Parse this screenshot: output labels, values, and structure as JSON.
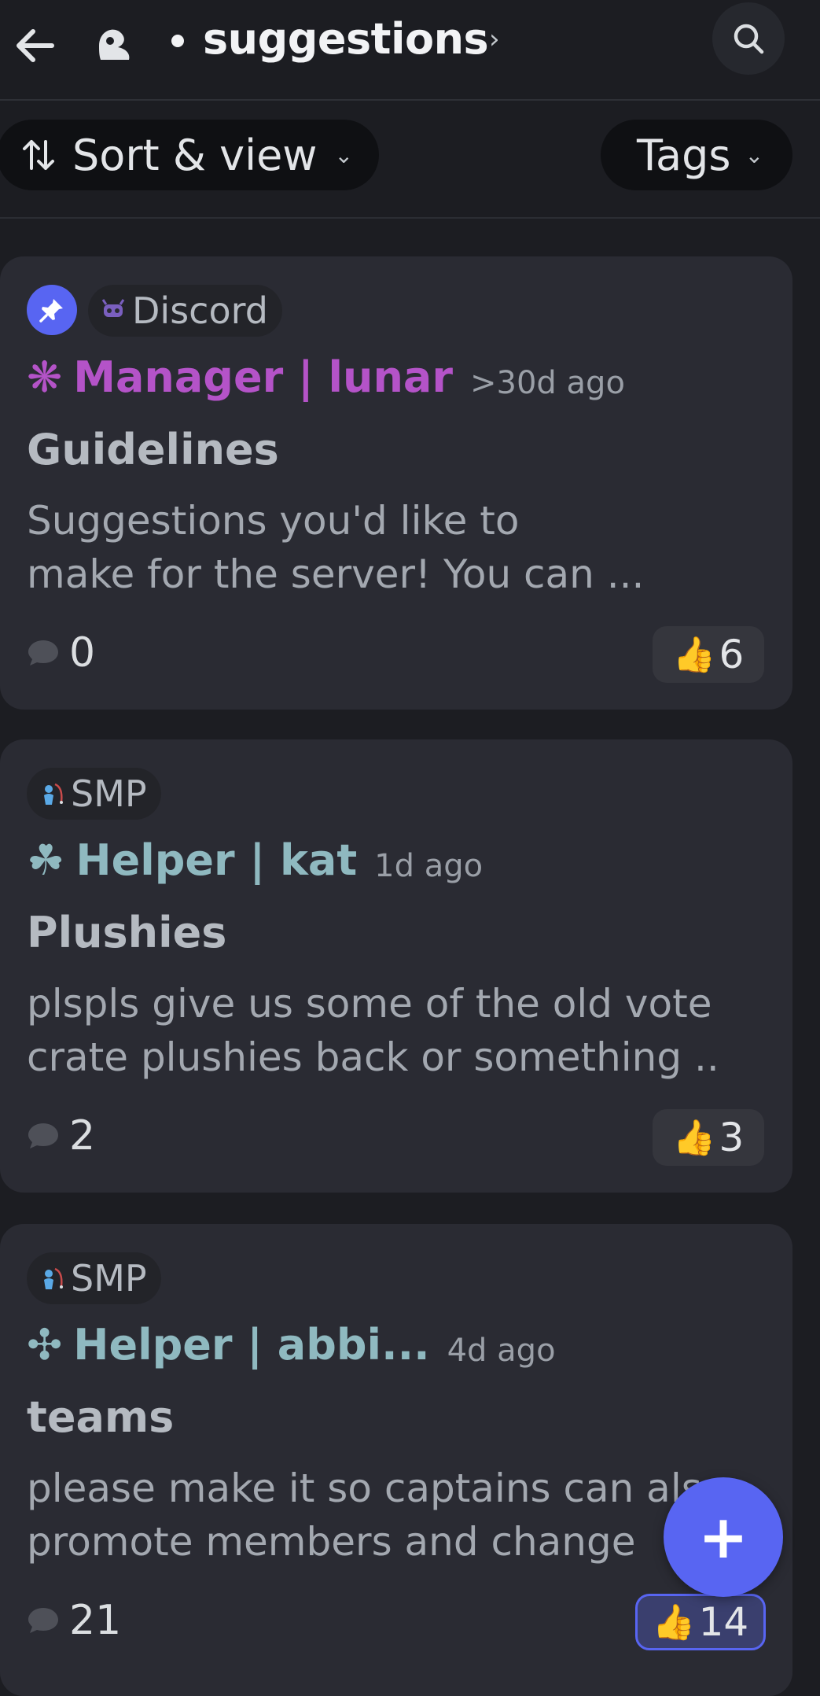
{
  "header": {
    "channel_name": "suggestions",
    "channel_chevron": "›",
    "back_icon": "arrow-left-icon",
    "server_icon": "server-icon",
    "search_icon": "search-icon"
  },
  "filters": {
    "sort_label": "Sort & view",
    "tags_label": "Tags",
    "chevron": "⌄"
  },
  "posts": [
    {
      "pinned": true,
      "tag": "Discord",
      "author_prefix": "❋",
      "author": "Manager | lunar",
      "author_color": "#b453c8",
      "time": ">30d ago",
      "title": "Guidelines",
      "body": [
        "Suggestions you'd like to",
        "make for the server! You can ..."
      ],
      "comments": "0",
      "reaction_emoji": "👍",
      "reaction_count": "6",
      "reacted": false
    },
    {
      "pinned": false,
      "tag": "SMP",
      "author_prefix": "☘",
      "author": "Helper | kat",
      "author_color": "#8fb9c0",
      "time": "1d ago",
      "title": "Plushies",
      "body": [
        "plspls give us some of the old vote",
        "crate plushies back or something .."
      ],
      "comments": "2",
      "reaction_emoji": "👍",
      "reaction_count": "3",
      "reacted": false
    },
    {
      "pinned": false,
      "tag": "SMP",
      "author_prefix": "✣",
      "author": "Helper | abbi...",
      "author_color": "#8fb9c0",
      "time": "4d ago",
      "title": "teams",
      "body": [
        "please make it so captains can also",
        "promote members and change"
      ],
      "comments": "21",
      "reaction_emoji": "👍",
      "reaction_count": "14",
      "reacted": true
    }
  ],
  "fab": {
    "label": "+"
  }
}
